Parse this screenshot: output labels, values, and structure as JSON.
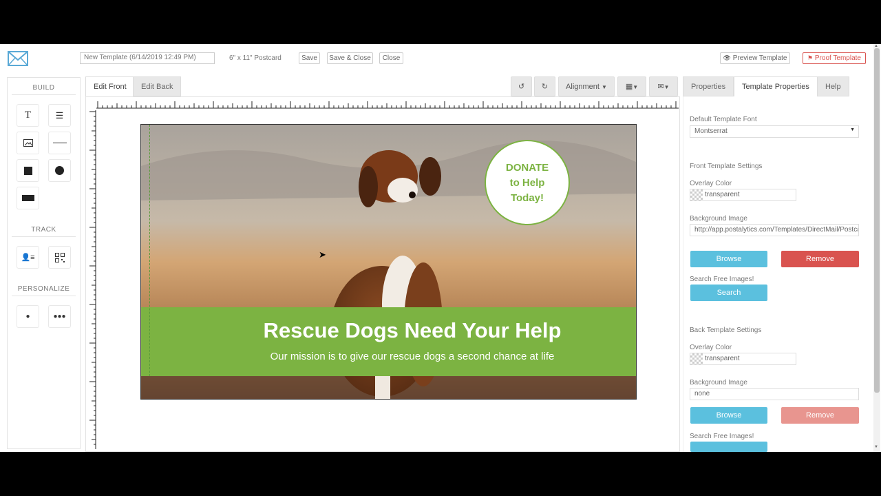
{
  "header": {
    "template_name": "New Template (6/14/2019 12:49 PM)",
    "size_label": "6\" x 11\" Postcard",
    "save_label": "Save",
    "save_close_label": "Save & Close",
    "close_label": "Close",
    "preview_label": "Preview Template",
    "proof_label": "Proof Template"
  },
  "left_panel": {
    "build_title": "BUILD",
    "track_title": "TRACK",
    "personalize_title": "PERSONALIZE"
  },
  "editor": {
    "tab_front": "Edit Front",
    "tab_back": "Edit Back",
    "alignment_label": "Alignment",
    "postcard": {
      "donate_line1": "DONATE",
      "donate_line2": "to Help",
      "donate_line3": "Today!",
      "headline": "Rescue Dogs Need Your Help",
      "subline": "Our mission is to give our rescue dogs a second chance at life",
      "band_color": "#7cb342"
    }
  },
  "right_panel": {
    "tab_properties": "Properties",
    "tab_template_properties": "Template Properties",
    "tab_help": "Help",
    "default_font_label": "Default Template Font",
    "default_font_value": "Montserrat",
    "front_settings_title": "Front Template Settings",
    "front_overlay_label": "Overlay Color",
    "front_overlay_value": "transparent",
    "front_bg_label": "Background Image",
    "front_bg_value": "http://app.postalytics.com/Templates/DirectMail/Postca",
    "browse_label": "Browse",
    "remove_label": "Remove",
    "search_free_label": "Search Free Images!",
    "search_label": "Search",
    "back_settings_title": "Back Template Settings",
    "back_overlay_label": "Overlay Color",
    "back_overlay_value": "transparent",
    "back_bg_label": "Background Image",
    "back_bg_value": "none",
    "back_search_free_label": "Search Free Images!"
  },
  "colors": {
    "browse": "#5bc0de",
    "remove": "#d9534f",
    "remove_disabled": "#e8958f",
    "proof_red": "#d9534f"
  }
}
